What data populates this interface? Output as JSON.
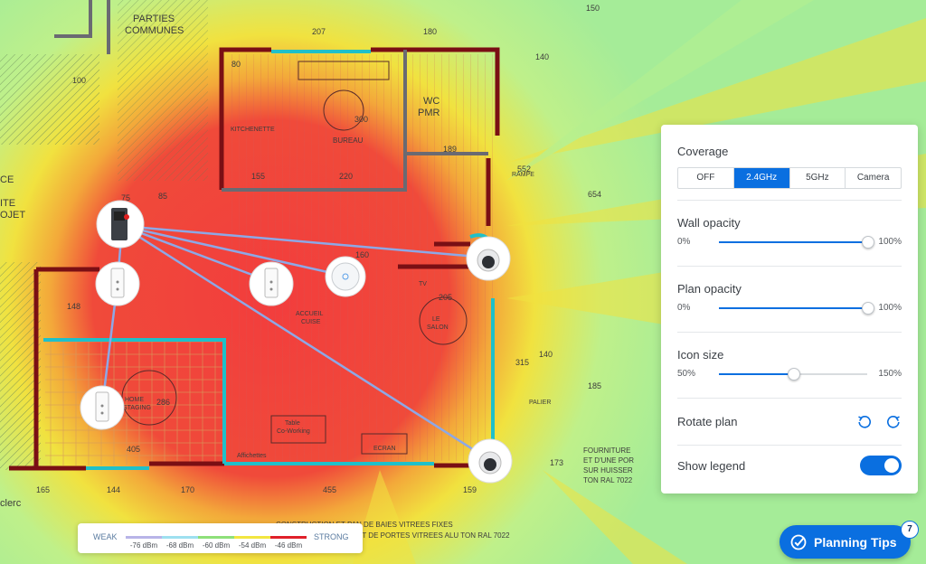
{
  "panel": {
    "coverage": {
      "label": "Coverage",
      "options": [
        "OFF",
        "2.4GHz",
        "5GHz",
        "Camera"
      ],
      "selected": "2.4GHz"
    },
    "wall_opacity": {
      "label": "Wall opacity",
      "min_label": "0%",
      "max_label": "100%",
      "value": 1.0
    },
    "plan_opacity": {
      "label": "Plan opacity",
      "min_label": "0%",
      "max_label": "100%",
      "value": 1.0
    },
    "icon_size": {
      "label": "Icon size",
      "min_label": "50%",
      "max_label": "150%",
      "value": 0.5
    },
    "rotate_plan": {
      "label": "Rotate plan",
      "icons": [
        "rotate-ccw-icon",
        "rotate-cw-icon"
      ]
    },
    "show_legend": {
      "label": "Show legend",
      "enabled": true
    }
  },
  "legend": {
    "weak_label": "WEAK",
    "strong_label": "STRONG",
    "levels": [
      "-76 dBm",
      "-68 dBm",
      "-60 dBm",
      "-54 dBm",
      "-46 dBm"
    ],
    "colors": [
      "#b8b4e8",
      "#9ee0f0",
      "#8ee07a",
      "#f2e640",
      "#e0202a"
    ]
  },
  "planning_tips": {
    "label": "Planning Tips",
    "badge": "7"
  },
  "plan": {
    "room_labels": [
      "PARTIES",
      "COMMUNES",
      "KITCHENETTE",
      "BUREAU",
      "WC",
      "PMR",
      "ACCUEIL",
      "CUISE",
      "LE",
      "SALON",
      "HOME",
      "STAGING",
      "ECRAN",
      "PALIER",
      "TV",
      "Table",
      "Co-Working",
      "RAMPE",
      "Affichettes",
      "CE",
      "ITE",
      "OJET",
      "FOURNITURE",
      "ET D'UNE POR",
      "SUR HUISSER",
      "TON RAL 7022",
      "clerc"
    ],
    "dimensions": [
      "207",
      "180",
      "140",
      "150",
      "80",
      "300",
      "189",
      "155",
      "220",
      "75",
      "85",
      "160",
      "205",
      "148",
      "286",
      "405",
      "144",
      "170",
      "455",
      "159",
      "165",
      "315",
      "185",
      "140",
      "173",
      "654",
      "552",
      "100"
    ],
    "bottom_note": "CONSTRUCTION ET PAN DE BAIES VITREES FIXES",
    "bottom_note2": "ET DE PORTES VITREES ALU TON RAL 7022"
  }
}
